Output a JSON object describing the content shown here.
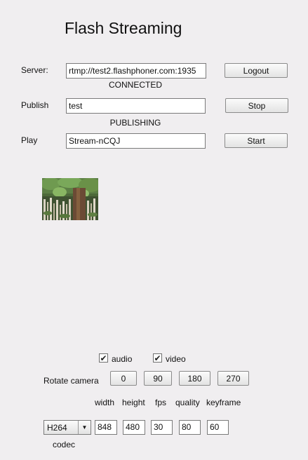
{
  "title": "Flash Streaming",
  "server": {
    "label": "Server:",
    "value": "rtmp://test2.flashphoner.com:1935",
    "button": "Logout",
    "status": "CONNECTED"
  },
  "publish": {
    "label": "Publish",
    "value": "test",
    "button": "Stop",
    "status": "PUBLISHING"
  },
  "play": {
    "label": "Play",
    "value": "Stream-nCQJ",
    "button": "Start"
  },
  "media": {
    "audio_label": "audio",
    "audio_checked": true,
    "video_label": "video",
    "video_checked": true
  },
  "rotate": {
    "label": "Rotate camera",
    "options": [
      "0",
      "90",
      "180",
      "270"
    ]
  },
  "params": {
    "headers": {
      "width": "width",
      "height": "height",
      "fps": "fps",
      "quality": "quality",
      "keyframe": "keyframe"
    },
    "codec_label": "codec",
    "codec_value": "H264",
    "width": "848",
    "height": "480",
    "fps": "30",
    "quality": "80",
    "keyframe": "60"
  },
  "colors": {
    "background": "#f0eef0",
    "border": "#7a7a7a"
  }
}
